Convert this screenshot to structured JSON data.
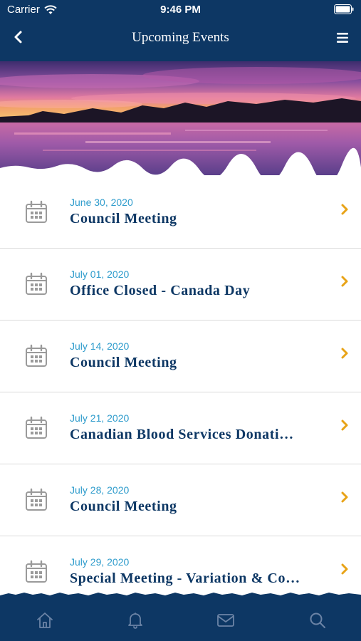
{
  "status_bar": {
    "carrier": "Carrier",
    "time": "9:46 PM"
  },
  "nav": {
    "title": "Upcoming Events"
  },
  "events": [
    {
      "date": "June 30, 2020",
      "title": "Council Meeting"
    },
    {
      "date": "July 01, 2020",
      "title": "Office Closed - Canada Day"
    },
    {
      "date": "July 14, 2020",
      "title": "Council Meeting"
    },
    {
      "date": "July 21, 2020",
      "title": "Canadian Blood Services Donati…"
    },
    {
      "date": "July 28, 2020",
      "title": "Council Meeting"
    },
    {
      "date": "July 29, 2020",
      "title": "Special Meeting - Variation & Co…"
    }
  ],
  "icons": {
    "back": "chevron-left-icon",
    "menu": "hamburger-menu-icon",
    "event": "calendar-icon",
    "row_action": "chevron-right-icon",
    "tabs": [
      "home-icon",
      "bell-icon",
      "mail-icon",
      "search-icon"
    ]
  },
  "colors": {
    "brand_navy": "#0d3764",
    "date_blue": "#2f9ccc",
    "chevron_orange": "#e8a317"
  }
}
